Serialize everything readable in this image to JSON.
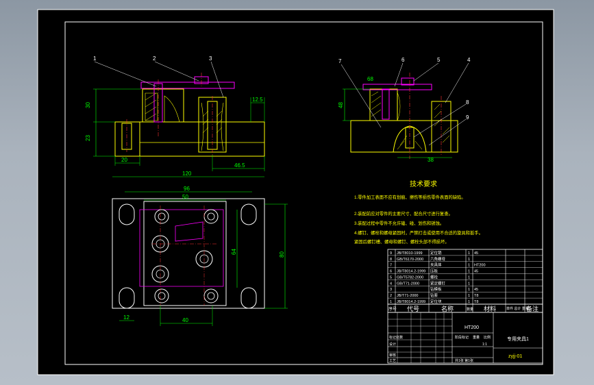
{
  "colors": {
    "background": "#000000",
    "frame": "#ffffff",
    "part": "#ffff00",
    "dimension": "#00ff00",
    "center": "#ff3333",
    "hidden": "#ff00ff",
    "hatch": "#ffff00",
    "leader": "#ffffff",
    "table_text": "#ffffff",
    "annotation": "#ffff00"
  },
  "callouts": {
    "c1": "1",
    "c2": "2",
    "c3": "3",
    "c4": "4",
    "c5": "5",
    "c6": "6",
    "c7": "7",
    "c8": "8",
    "c9": "9"
  },
  "dimensions": {
    "front_height_top": "30",
    "front_height_base": "23",
    "front_foot": "20",
    "front_right_offset": "12.5",
    "front_width_bottom": "46.5",
    "side_top": "68",
    "side_mid": "48",
    "side_bottom": "38",
    "top_overall": "120",
    "top_96": "96",
    "top_50": "50",
    "top_12": "12",
    "top_40": "40",
    "top_vertical": "80",
    "top_vertical_inner": "64"
  },
  "tech_requirements": {
    "title": "技术要求",
    "lines": [
      "1.零件加工表面不应有划痕、擦伤等损伤零件表面的缺陷。",
      "2.装配前应对零件的主要尺寸、配合尺寸进行复查。",
      "3.装配过程中零件不允许磕、碰、划伤和锈蚀。",
      "4.螺钉、螺栓和螺母紧固时，严禁打击或使用不合适的旋具和扳手。",
      "紧固后螺钉槽、螺母和螺钉、螺栓头部不得损坏。"
    ]
  },
  "bom": {
    "rows": [
      {
        "no": "9",
        "code": "JB/T8010-1999",
        "name": "定位销",
        "qty": "1",
        "note": "45"
      },
      {
        "no": "8",
        "code": "GB/T6170-2000",
        "name": "六角螺母",
        "qty": "1",
        "note": ""
      },
      {
        "no": "7",
        "code": "",
        "name": "夹具体",
        "qty": "1",
        "note": "HT200"
      },
      {
        "no": "6",
        "code": "JB/T8014.2-1999",
        "name": "压板",
        "qty": "1",
        "note": "45"
      },
      {
        "no": "5",
        "code": "GB/T5782-2000",
        "name": "螺栓",
        "qty": "1",
        "note": ""
      },
      {
        "no": "4",
        "code": "GB/T71-2000",
        "name": "紧定螺钉",
        "qty": "1",
        "note": ""
      },
      {
        "no": "3",
        "code": "",
        "name": "钻模板",
        "qty": "1",
        "note": "45"
      },
      {
        "no": "2",
        "code": "JB/T71-2000",
        "name": "钻套",
        "qty": "1",
        "note": "T8"
      },
      {
        "no": "1",
        "code": "JB/T8014.2-1999",
        "name": "定位块",
        "qty": "1",
        "note": "T8"
      }
    ],
    "header": {
      "no": "序号",
      "code": "代号",
      "name": "名称",
      "qty": "数量",
      "material": "材料",
      "weight": "单件 总计 重量",
      "note": "备注"
    }
  },
  "title_block": {
    "company": "标记处数",
    "drawing_name": "专用夹具1",
    "drawing_no": "zyjj-01",
    "design": "设计",
    "check": "审核",
    "process": "工艺",
    "stage": "阶段标记",
    "weight": "重量",
    "scale": "比例",
    "ratio": "1:1",
    "sheet": "共1张 第1张",
    "material_center": "HT200"
  }
}
